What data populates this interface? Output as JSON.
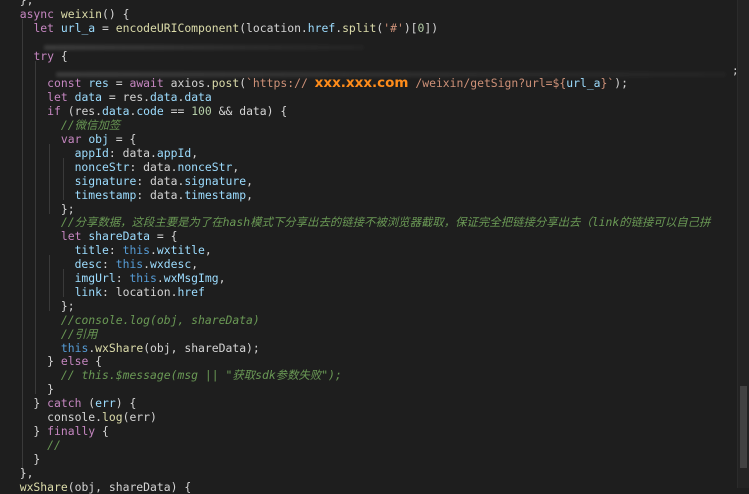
{
  "colors": {
    "background": "#1e1e1e",
    "plain": "#d4d4d4",
    "keyword": "#c586c0",
    "function": "#dcdcaa",
    "variable": "#9cdcfe",
    "property": "#4ec9b0",
    "string": "#ce9178",
    "number": "#b5cea8",
    "comment": "#6a9955",
    "this": "#569cd6",
    "highlight": "#ff8c1a"
  },
  "editor": {
    "language": "javascript",
    "lines": [
      [
        {
          "t": "  },",
          "c": "plain"
        }
      ],
      [
        {
          "t": "  ",
          "c": "plain"
        },
        {
          "t": "async",
          "c": "keyword"
        },
        {
          "t": " ",
          "c": "plain"
        },
        {
          "t": "weixin",
          "c": "function"
        },
        {
          "t": "() {",
          "c": "plain"
        }
      ],
      [
        {
          "t": "    ",
          "c": "plain"
        },
        {
          "t": "let",
          "c": "keyword"
        },
        {
          "t": " ",
          "c": "plain"
        },
        {
          "t": "url_a",
          "c": "variable"
        },
        {
          "t": " = ",
          "c": "plain"
        },
        {
          "t": "encodeURIComponent",
          "c": "function"
        },
        {
          "t": "(location.",
          "c": "plain"
        },
        {
          "t": "href",
          "c": "variable"
        },
        {
          "t": ".",
          "c": "plain"
        },
        {
          "t": "split",
          "c": "function"
        },
        {
          "t": "(",
          "c": "plain"
        },
        {
          "t": "'#'",
          "c": "string"
        },
        {
          "t": ")[",
          "c": "plain"
        },
        {
          "t": "0",
          "c": "number"
        },
        {
          "t": "])",
          "c": "plain"
        }
      ],
      [],
      [
        {
          "t": "    ",
          "c": "plain"
        },
        {
          "t": "try",
          "c": "keyword"
        },
        {
          "t": " {",
          "c": "plain"
        }
      ],
      [],
      [
        {
          "t": "      ",
          "c": "plain"
        },
        {
          "t": "const",
          "c": "keyword"
        },
        {
          "t": " ",
          "c": "plain"
        },
        {
          "t": "res",
          "c": "variable"
        },
        {
          "t": " = ",
          "c": "plain"
        },
        {
          "t": "await",
          "c": "keyword"
        },
        {
          "t": " axios.",
          "c": "plain"
        },
        {
          "t": "post",
          "c": "function"
        },
        {
          "t": "(",
          "c": "plain"
        },
        {
          "t": "`https:// ",
          "c": "string"
        },
        {
          "t": "xxx.xxx.com",
          "c": "highlight"
        },
        {
          "t": " /weixin/getSign?url=${",
          "c": "string"
        },
        {
          "t": "url_a",
          "c": "variable"
        },
        {
          "t": "}`",
          "c": "string"
        },
        {
          "t": ");",
          "c": "plain"
        }
      ],
      [
        {
          "t": "      ",
          "c": "plain"
        },
        {
          "t": "let",
          "c": "keyword"
        },
        {
          "t": " ",
          "c": "plain"
        },
        {
          "t": "data",
          "c": "variable"
        },
        {
          "t": " = res.",
          "c": "plain"
        },
        {
          "t": "data",
          "c": "variable"
        },
        {
          "t": ".",
          "c": "plain"
        },
        {
          "t": "data",
          "c": "variable"
        }
      ],
      [
        {
          "t": "      ",
          "c": "plain"
        },
        {
          "t": "if",
          "c": "keyword"
        },
        {
          "t": " (res.",
          "c": "plain"
        },
        {
          "t": "data",
          "c": "variable"
        },
        {
          "t": ".",
          "c": "plain"
        },
        {
          "t": "code",
          "c": "variable"
        },
        {
          "t": " == ",
          "c": "plain"
        },
        {
          "t": "100",
          "c": "number"
        },
        {
          "t": " && data) {",
          "c": "plain"
        }
      ],
      [
        {
          "t": "        ",
          "c": "plain"
        },
        {
          "t": "//微信加签",
          "c": "comment"
        }
      ],
      [
        {
          "t": "        ",
          "c": "plain"
        },
        {
          "t": "var",
          "c": "keyword"
        },
        {
          "t": " ",
          "c": "plain"
        },
        {
          "t": "obj",
          "c": "variable"
        },
        {
          "t": " = {",
          "c": "plain"
        }
      ],
      [
        {
          "t": "          ",
          "c": "plain"
        },
        {
          "t": "appId",
          "c": "variable"
        },
        {
          "t": ": data.",
          "c": "plain"
        },
        {
          "t": "appId",
          "c": "variable"
        },
        {
          "t": ",",
          "c": "plain"
        }
      ],
      [
        {
          "t": "          ",
          "c": "plain"
        },
        {
          "t": "nonceStr",
          "c": "variable"
        },
        {
          "t": ": data.",
          "c": "plain"
        },
        {
          "t": "nonceStr",
          "c": "variable"
        },
        {
          "t": ",",
          "c": "plain"
        }
      ],
      [
        {
          "t": "          ",
          "c": "plain"
        },
        {
          "t": "signature",
          "c": "variable"
        },
        {
          "t": ": data.",
          "c": "plain"
        },
        {
          "t": "signature",
          "c": "variable"
        },
        {
          "t": ",",
          "c": "plain"
        }
      ],
      [
        {
          "t": "          ",
          "c": "plain"
        },
        {
          "t": "timestamp",
          "c": "variable"
        },
        {
          "t": ": data.",
          "c": "plain"
        },
        {
          "t": "timestamp",
          "c": "variable"
        },
        {
          "t": ",",
          "c": "plain"
        }
      ],
      [
        {
          "t": "        };",
          "c": "plain"
        }
      ],
      [
        {
          "t": "        ",
          "c": "plain"
        },
        {
          "t": "//分享数据，这段主要是为了在hash模式下分享出去的链接不被浏览器截取，保证完全把链接分享出去（link的链接可以自己拼",
          "c": "comment"
        }
      ],
      [
        {
          "t": "        ",
          "c": "plain"
        },
        {
          "t": "let",
          "c": "keyword"
        },
        {
          "t": " ",
          "c": "plain"
        },
        {
          "t": "shareData",
          "c": "variable"
        },
        {
          "t": " = {",
          "c": "plain"
        }
      ],
      [
        {
          "t": "          ",
          "c": "plain"
        },
        {
          "t": "title",
          "c": "variable"
        },
        {
          "t": ": ",
          "c": "plain"
        },
        {
          "t": "this",
          "c": "this"
        },
        {
          "t": ".",
          "c": "plain"
        },
        {
          "t": "wxtitle",
          "c": "variable"
        },
        {
          "t": ",",
          "c": "plain"
        }
      ],
      [
        {
          "t": "          ",
          "c": "plain"
        },
        {
          "t": "desc",
          "c": "variable"
        },
        {
          "t": ": ",
          "c": "plain"
        },
        {
          "t": "this",
          "c": "this"
        },
        {
          "t": ".",
          "c": "plain"
        },
        {
          "t": "wxdesc",
          "c": "variable"
        },
        {
          "t": ",",
          "c": "plain"
        }
      ],
      [
        {
          "t": "          ",
          "c": "plain"
        },
        {
          "t": "imgUrl",
          "c": "variable"
        },
        {
          "t": ": ",
          "c": "plain"
        },
        {
          "t": "this",
          "c": "this"
        },
        {
          "t": ".",
          "c": "plain"
        },
        {
          "t": "wxMsgImg",
          "c": "variable"
        },
        {
          "t": ",",
          "c": "plain"
        }
      ],
      [
        {
          "t": "          ",
          "c": "plain"
        },
        {
          "t": "link",
          "c": "variable"
        },
        {
          "t": ": location.",
          "c": "plain"
        },
        {
          "t": "href",
          "c": "variable"
        }
      ],
      [
        {
          "t": "        };",
          "c": "plain"
        }
      ],
      [
        {
          "t": "        ",
          "c": "plain"
        },
        {
          "t": "//console.log(obj, shareData)",
          "c": "comment"
        }
      ],
      [
        {
          "t": "        ",
          "c": "plain"
        },
        {
          "t": "//引用",
          "c": "comment"
        }
      ],
      [
        {
          "t": "        ",
          "c": "plain"
        },
        {
          "t": "this",
          "c": "this"
        },
        {
          "t": ".",
          "c": "plain"
        },
        {
          "t": "wxShare",
          "c": "function"
        },
        {
          "t": "(obj, shareData);",
          "c": "plain"
        }
      ],
      [
        {
          "t": "      } ",
          "c": "plain"
        },
        {
          "t": "else",
          "c": "keyword"
        },
        {
          "t": " {",
          "c": "plain"
        }
      ],
      [
        {
          "t": "        ",
          "c": "plain"
        },
        {
          "t": "// this.$message(msg || \"获取sdk参数失败\");",
          "c": "comment"
        }
      ],
      [
        {
          "t": "      }",
          "c": "plain"
        }
      ],
      [
        {
          "t": "    } ",
          "c": "plain"
        },
        {
          "t": "catch",
          "c": "keyword"
        },
        {
          "t": " (",
          "c": "plain"
        },
        {
          "t": "err",
          "c": "variable"
        },
        {
          "t": ") {",
          "c": "plain"
        }
      ],
      [
        {
          "t": "      console.",
          "c": "plain"
        },
        {
          "t": "log",
          "c": "function"
        },
        {
          "t": "(err)",
          "c": "plain"
        }
      ],
      [
        {
          "t": "    } ",
          "c": "plain"
        },
        {
          "t": "finally",
          "c": "keyword"
        },
        {
          "t": " {",
          "c": "plain"
        }
      ],
      [
        {
          "t": "      ",
          "c": "plain"
        },
        {
          "t": "//",
          "c": "comment"
        }
      ],
      [
        {
          "t": "    }",
          "c": "plain"
        }
      ],
      [
        {
          "t": "  },",
          "c": "plain"
        }
      ],
      [
        {
          "t": "  ",
          "c": "plain"
        },
        {
          "t": "wxShare",
          "c": "function"
        },
        {
          "t": "(obj, shareData) {",
          "c": "plain"
        }
      ]
    ]
  },
  "scrollbar": {
    "thumb_start_fraction": 0.79,
    "thumb_size_fraction": 0.17
  }
}
